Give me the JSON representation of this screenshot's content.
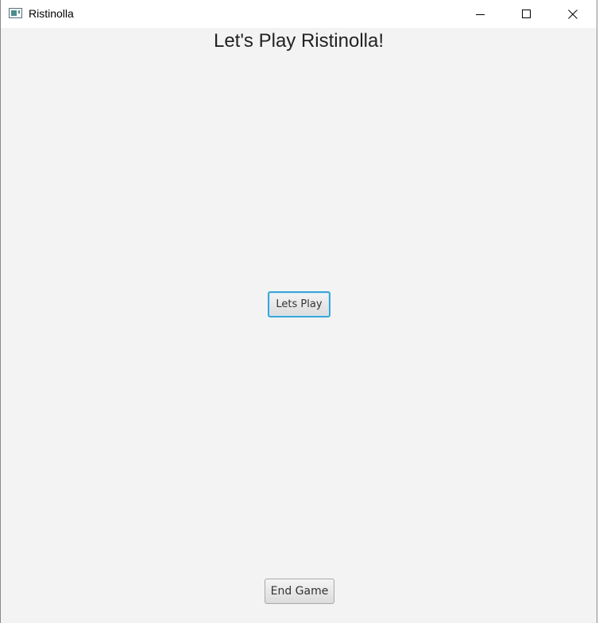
{
  "window": {
    "title": "Ristinolla",
    "controls": {
      "minimize_icon": "minimize-icon",
      "maximize_icon": "maximize-icon",
      "close_icon": "close-icon"
    }
  },
  "main": {
    "heading": "Let's Play Ristinolla!",
    "play_button": "Lets Play",
    "end_button": "End Game"
  },
  "colors": {
    "background": "#f3f3f3",
    "focus_border": "#3aa4d8"
  }
}
